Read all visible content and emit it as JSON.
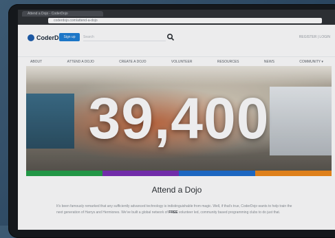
{
  "browser": {
    "tab_title": "Attend a Dojo - CoderDojo",
    "url": "coderdojo.com/attend-a-dojo"
  },
  "header": {
    "logo_text": "CoderDojo",
    "signup_label": "Sign up",
    "search_placeholder": "Search",
    "account_links": "REGISTER | LOGIN"
  },
  "nav": {
    "items": [
      "ABOUT",
      "ATTEND A DOJO",
      "CREATE A DOJO",
      "VOLUNTEER",
      "RESOURCES",
      "NEWS",
      "COMMUNITY ▾"
    ]
  },
  "hero": {
    "stat": "39,400"
  },
  "color_strip": [
    "#24a24a",
    "#7a2fb6",
    "#1f6fd0",
    "#f08a1c"
  ],
  "section": {
    "title": "Attend a Dojo",
    "line1": "It's been famously remarked that any sufficiently advanced technology is indistinguishable from magic. Well, if that's true,",
    "line2_prefix": "CoderDojo wants to help train the next generation of Harrys and Hermiones. We've built a global network of ",
    "line2_bold": "FREE",
    "line2_suffix": " volunteer",
    "line3": "led, community based programming clubs to do just that."
  },
  "colors": {
    "background": "#2b4660",
    "accent_blue": "#1e7fd6",
    "frame": "#15181c"
  }
}
